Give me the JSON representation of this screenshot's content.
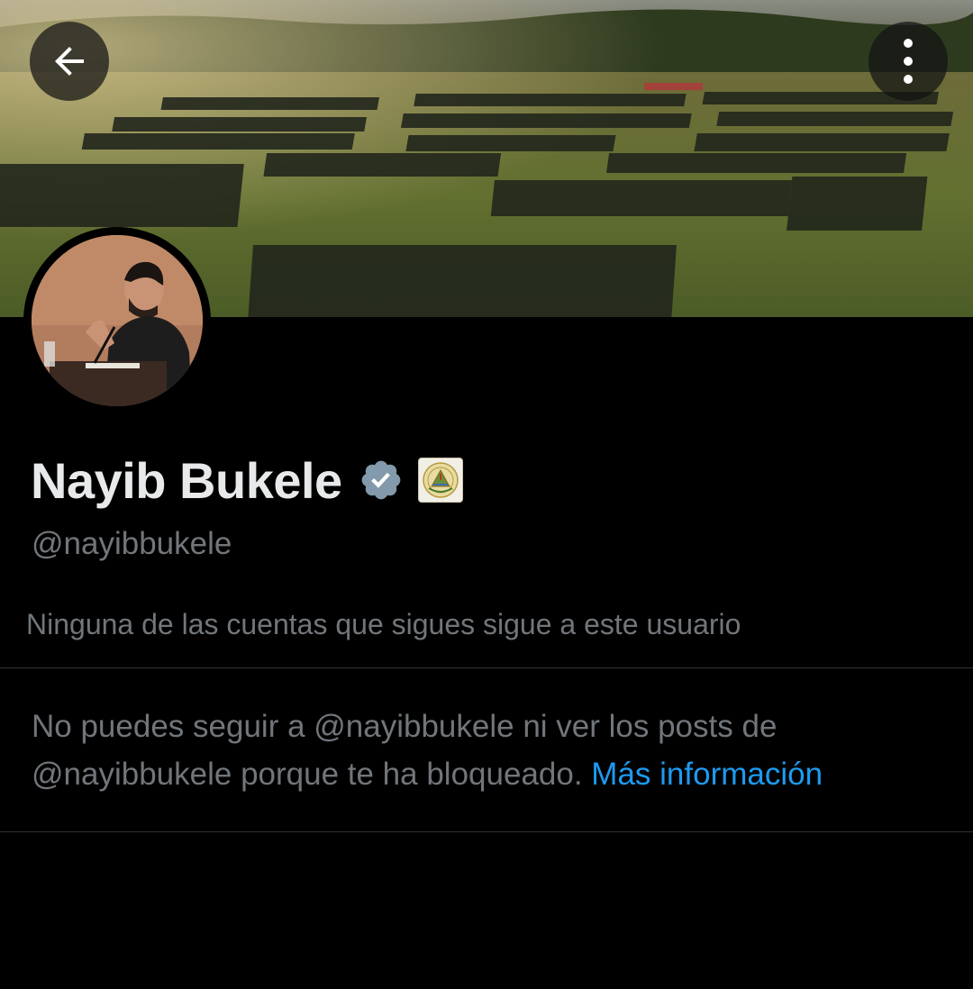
{
  "header": {
    "back_icon": "arrow-left-icon",
    "more_icon": "more-vertical-icon"
  },
  "profile": {
    "display_name": "Nayib Bukele",
    "verified_icon": "verified-badge-icon",
    "affiliation_icon": "el-salvador-coat-of-arms-icon",
    "handle": "@nayibbukele",
    "followers_you_know": "Ninguna de las cuentas que sigues sigue a este usuario"
  },
  "blocked_notice": {
    "text": "No puedes seguir a @nayibbukele ni ver los posts de @nayibbukele porque te ha bloqueado.",
    "link_label": "Más información"
  },
  "colors": {
    "background": "#000000",
    "primary_text": "#e7e9ea",
    "secondary_text": "#71767b",
    "link": "#1d9bf0",
    "verified_badge": "#829aab",
    "divider": "#2f3336"
  }
}
